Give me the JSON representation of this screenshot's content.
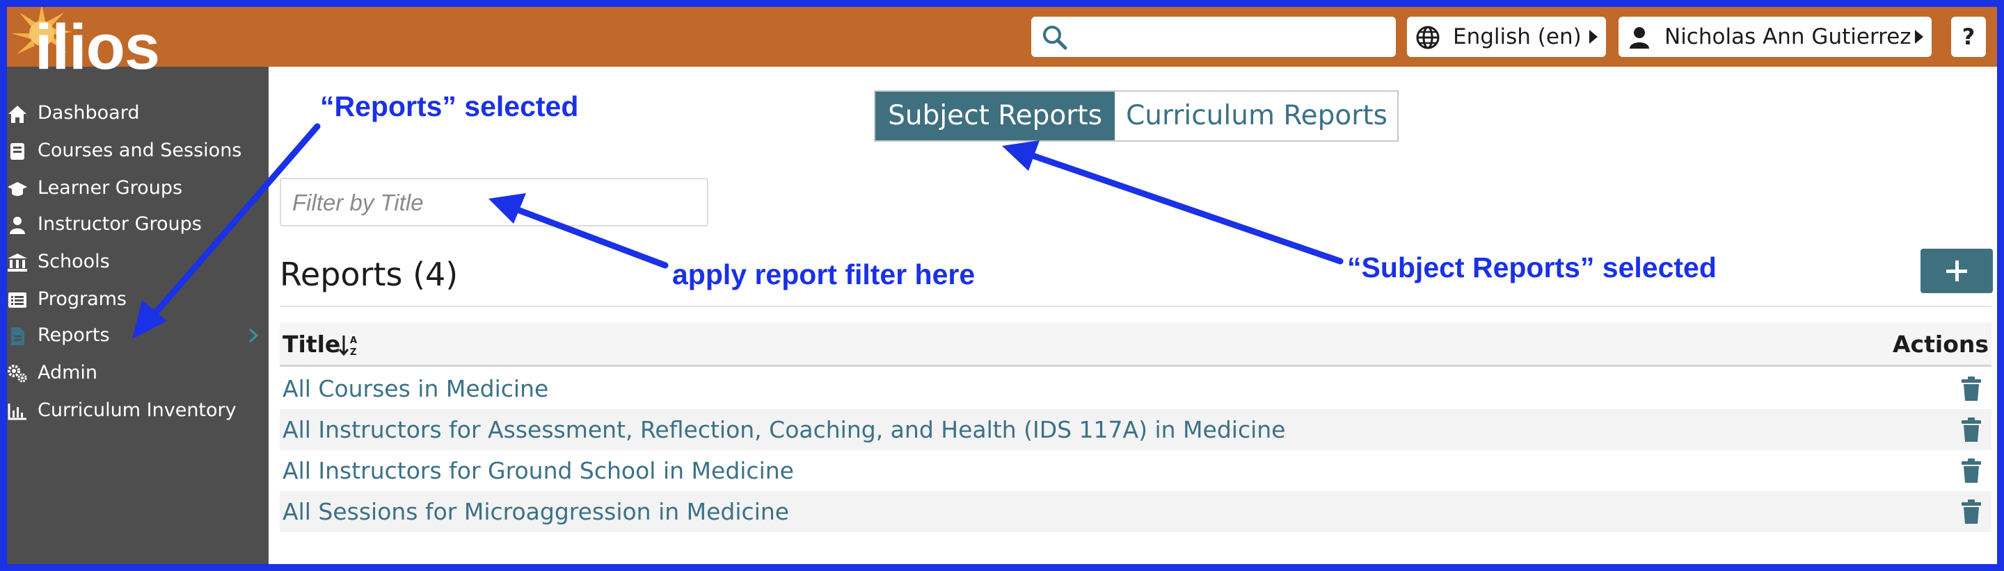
{
  "app": {
    "logo_text": "ilios"
  },
  "header": {
    "search": {
      "placeholder": "",
      "value": ""
    },
    "language_label": "English (en)",
    "user_label": "Nicholas Ann Gutierrez",
    "help_label": "?"
  },
  "sidebar": {
    "items": [
      {
        "label": "Dashboard",
        "icon": "home-icon"
      },
      {
        "label": "Courses and Sessions",
        "icon": "book-icon"
      },
      {
        "label": "Learner Groups",
        "icon": "graduation-cap-icon"
      },
      {
        "label": "Instructor Groups",
        "icon": "instructor-icon"
      },
      {
        "label": "Schools",
        "icon": "university-icon"
      },
      {
        "label": "Programs",
        "icon": "list-icon"
      },
      {
        "label": "Reports",
        "icon": "file-icon",
        "active": true
      },
      {
        "label": "Admin",
        "icon": "gears-icon"
      },
      {
        "label": "Curriculum Inventory",
        "icon": "chart-icon"
      }
    ]
  },
  "main": {
    "tabs": [
      {
        "label": "Subject Reports",
        "active": true
      },
      {
        "label": "Curriculum Reports",
        "active": false
      }
    ],
    "filter": {
      "placeholder": "Filter by Title",
      "value": ""
    },
    "reports_heading": "Reports (4)",
    "add_button": "+",
    "table": {
      "columns": [
        "Title",
        "Actions"
      ],
      "rows": [
        {
          "title": "All Courses in Medicine"
        },
        {
          "title": "All Instructors for Assessment, Reflection, Coaching, and Health (IDS 117A) in Medicine"
        },
        {
          "title": "All Instructors for Ground School in Medicine"
        },
        {
          "title": "All Sessions for Microaggression in Medicine"
        }
      ]
    }
  },
  "annotations": {
    "reports_selected": "“Reports” selected",
    "apply_filter": "apply report filter here",
    "subject_reports_selected": "“Subject Reports” selected"
  },
  "colors": {
    "header": "#c0692a",
    "sidebar": "#4e4e4e",
    "accent": "#3f7080",
    "link": "#3b7187",
    "annotation": "#1a31e6"
  }
}
